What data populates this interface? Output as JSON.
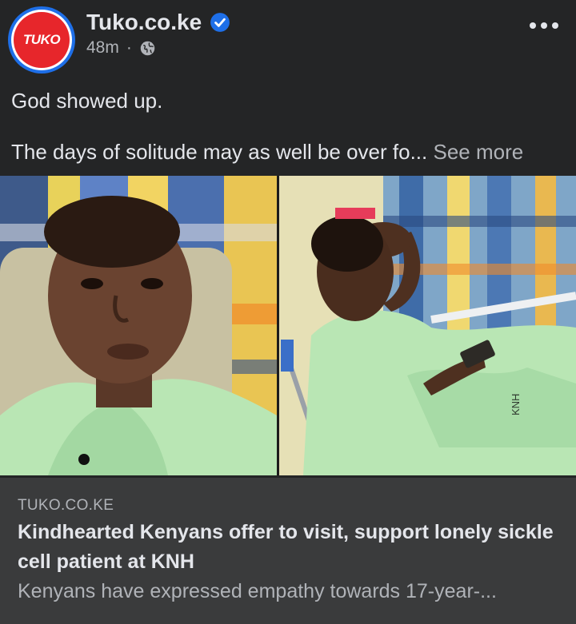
{
  "post": {
    "page_name": "Tuko.co.ke",
    "avatar_text": "TUKO",
    "timestamp": "48m",
    "separator": "·",
    "audience_icon": "globe-icon",
    "verified_icon": "verified-badge-icon",
    "more_icon": "more-options-icon",
    "text_line1": "God showed up.",
    "text_line2": "The days of solitude may as well be over fo...",
    "see_more": "See more"
  },
  "images": {
    "left_alt": "boy in hospital gown speaking",
    "right_alt": "boy lying in hospital bed holding phone",
    "gown_text": "KNH"
  },
  "link_card": {
    "domain": "TUKO.CO.KE",
    "headline": "Kindhearted Kenyans offer to visit, support lonely sickle cell patient at KNH",
    "description": "Kenyans have expressed empathy towards 17-year-..."
  },
  "colors": {
    "background": "#242526",
    "card": "#3a3b3c",
    "brand_red": "#e7262b",
    "verified_blue": "#1e6fe8"
  }
}
